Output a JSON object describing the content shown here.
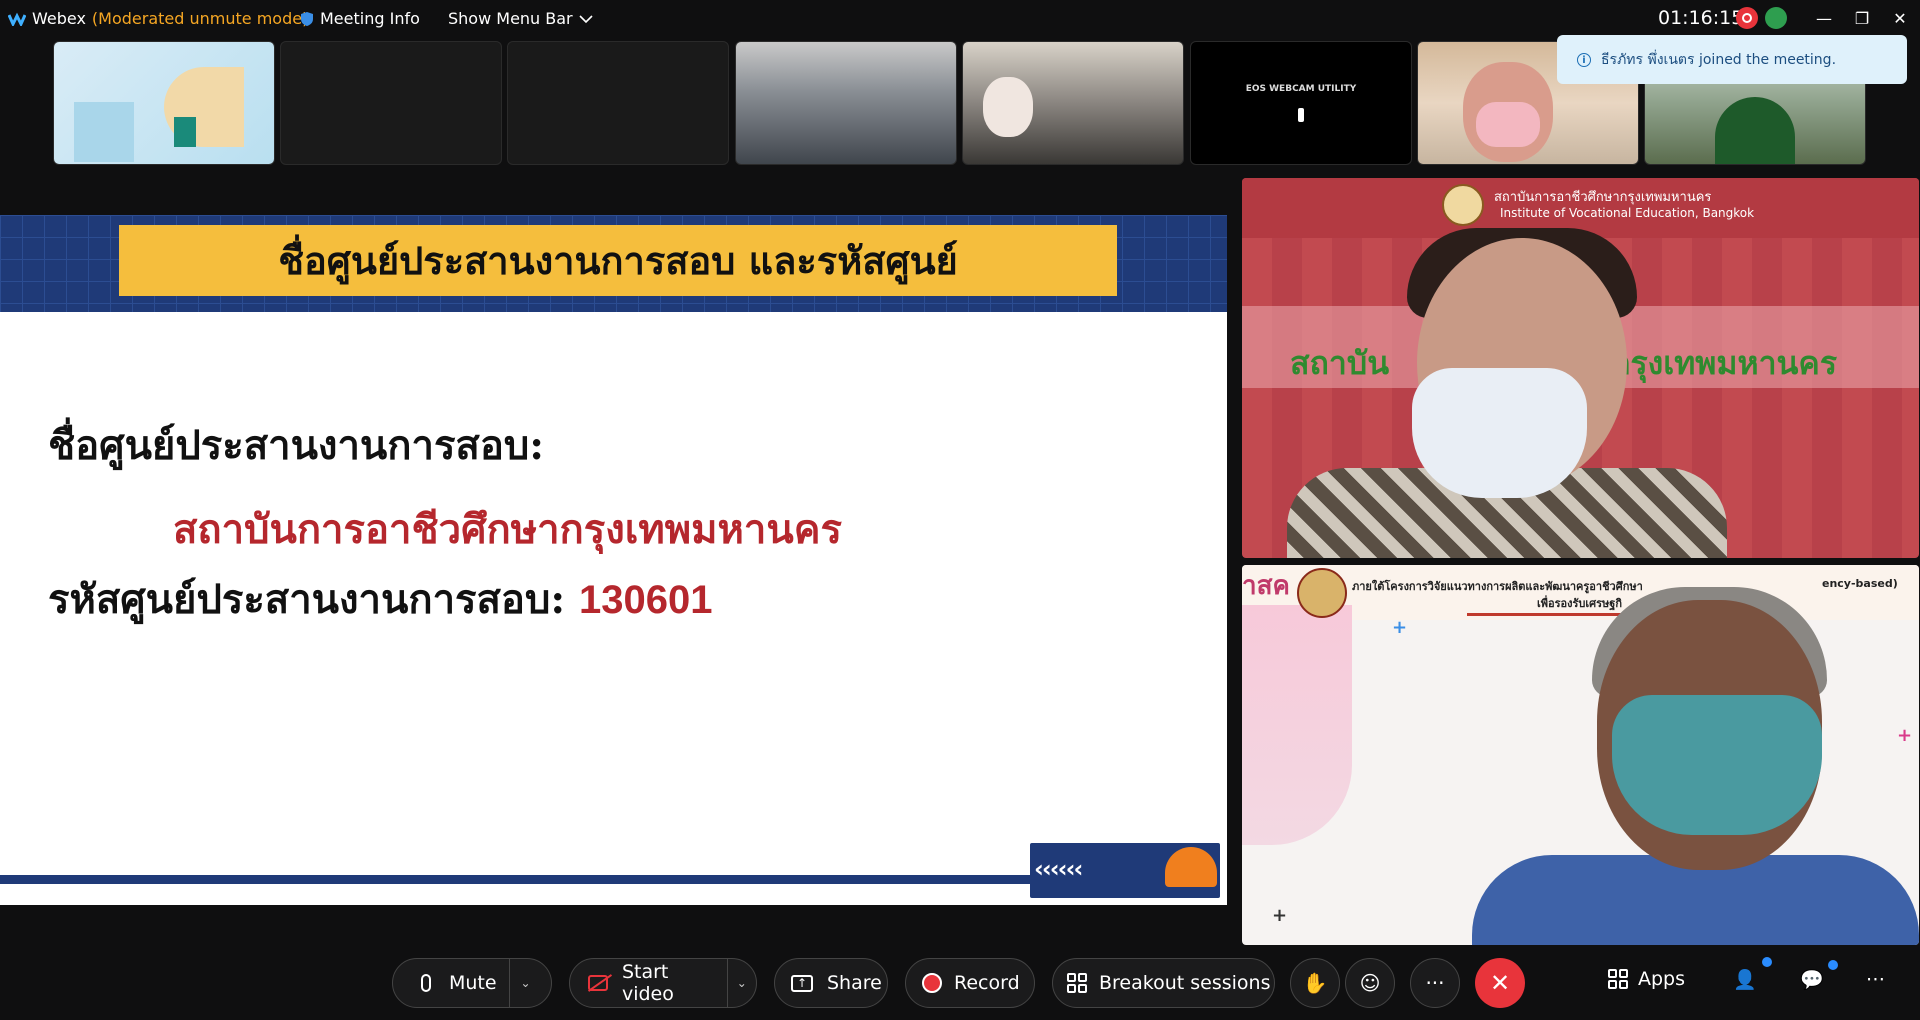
{
  "titlebar": {
    "app_name": "Webex",
    "mode": "(Moderated unmute mode)",
    "meeting_info": "Meeting Info",
    "show_menu_bar": "Show Menu Bar",
    "clock": "01:16:15",
    "minimize": "—",
    "restore": "❐",
    "close": "✕"
  },
  "thumbnails": {
    "eos_label": "EOS WEBCAM UTILITY"
  },
  "toast": {
    "message": "ธีรภัทร พึ่งเนตร joined the meeting."
  },
  "slide": {
    "title": "ชื่อศูนย์ประสานงานการสอบ และรหัสศูนย์",
    "center_label": "ชื่อศูนย์ประสานงานการสอบ:",
    "center_name": "สถาบันการอาชีวศึกษากรุงเทพมหานคร",
    "code_label": "รหัสศูนย์ประสานงานการสอบ:",
    "code_value": "130601",
    "arrows": "‹‹‹‹‹‹"
  },
  "video1": {
    "logo_line1": "สถาบันการอาชีวศึกษากรุงเทพมหานคร",
    "logo_line2": "Institute of Vocational Education, Bangkok",
    "banner_left": "สถาบัน",
    "banner_right": "ษากรุงเทพมหานคร"
  },
  "video2": {
    "left_text": "าสค",
    "header_text": "ภายใต้โครงการวิจัยแนวทางการผลิตและพัฒนาครูอาชีวศึกษา",
    "header_right": "ency-based)",
    "sub_text": "เพื่อรองรับเศรษฐกิ",
    "plus": "+"
  },
  "toolbar": {
    "mute": "Mute",
    "start_video": "Start video",
    "share": "Share",
    "record": "Record",
    "breakout": "Breakout sessions",
    "raise_hand": "✋",
    "reactions": "☺",
    "more": "···",
    "end": "✕",
    "apps": "Apps",
    "participants": "👤",
    "chat": "💬",
    "overflow": "⋯",
    "caret": "⌄"
  },
  "colors": {
    "accent_red": "#e8343b",
    "slide_navy": "#1f3a78",
    "slide_gold": "#f5be3d",
    "slide_red_text": "#b5272d",
    "webex_mode": "#f5a623"
  }
}
